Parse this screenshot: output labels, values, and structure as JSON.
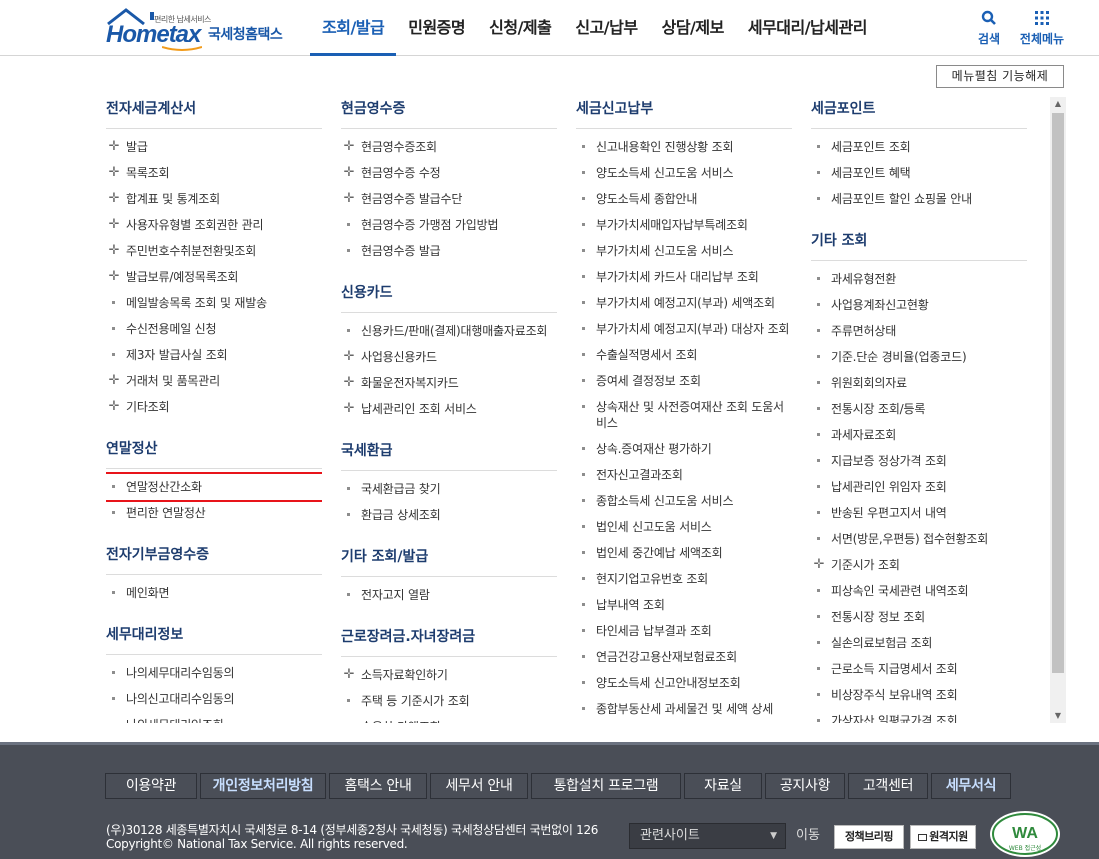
{
  "header": {
    "logo": {
      "small": "편리한 납세서비스",
      "home": "Home",
      "tax": "tax",
      "kr": "국세청홈택스"
    },
    "nav": [
      "조회/발급",
      "민원증명",
      "신청/제출",
      "신고/납부",
      "상담/제보",
      "세무대리/납세관리"
    ],
    "search_label": "검색",
    "all_menu_label": "전체메뉴"
  },
  "fold_button": "메뉴펼침 기능해제",
  "columns": [
    {
      "sections": [
        {
          "title": "전자세금계산서",
          "items": [
            {
              "label": "발급",
              "bullet": "plus"
            },
            {
              "label": "목록조회",
              "bullet": "plus"
            },
            {
              "label": "합계표 및 통계조회",
              "bullet": "plus"
            },
            {
              "label": "사용자유형별 조회권한 관리",
              "bullet": "plus"
            },
            {
              "label": "주민번호수취분전환및조회",
              "bullet": "plus"
            },
            {
              "label": "발급보류/예정목록조회",
              "bullet": "plus"
            },
            {
              "label": "메일발송목록 조회 및 재발송",
              "bullet": "dot"
            },
            {
              "label": "수신전용메일 신청",
              "bullet": "dot"
            },
            {
              "label": "제3자 발급사실 조회",
              "bullet": "dot"
            },
            {
              "label": "거래처 및 품목관리",
              "bullet": "plus"
            },
            {
              "label": "기타조회",
              "bullet": "plus"
            }
          ]
        },
        {
          "title": "연말정산",
          "items": [
            {
              "label": "연말정산간소화",
              "bullet": "dot",
              "highlight": true
            },
            {
              "label": "편리한 연말정산",
              "bullet": "dot"
            }
          ]
        },
        {
          "title": "전자기부금영수증",
          "items": [
            {
              "label": "메인화면",
              "bullet": "dot"
            }
          ]
        },
        {
          "title": "세무대리정보",
          "items": [
            {
              "label": "나의세무대리수임동의",
              "bullet": "dot"
            },
            {
              "label": "나의신고대리수임동의",
              "bullet": "dot"
            },
            {
              "label": "나의세무대리인조회",
              "bullet": "dot"
            }
          ]
        }
      ]
    },
    {
      "sections": [
        {
          "title": "현금영수증",
          "items": [
            {
              "label": "현금영수증조회",
              "bullet": "plus"
            },
            {
              "label": "현금영수증 수정",
              "bullet": "plus"
            },
            {
              "label": "현금영수증 발급수단",
              "bullet": "plus"
            },
            {
              "label": "현금영수증 가맹점 가입방법",
              "bullet": "dot"
            },
            {
              "label": "현금영수증 발급",
              "bullet": "dot"
            }
          ]
        },
        {
          "title": "신용카드",
          "items": [
            {
              "label": "신용카드/판매(결제)대행매출자료조회",
              "bullet": "dot"
            },
            {
              "label": "사업용신용카드",
              "bullet": "plus"
            },
            {
              "label": "화물운전자복지카드",
              "bullet": "plus"
            },
            {
              "label": "납세관리인 조회 서비스",
              "bullet": "plus"
            }
          ]
        },
        {
          "title": "국세환급",
          "items": [
            {
              "label": "국세환급금 찾기",
              "bullet": "dot"
            },
            {
              "label": "환급금 상세조회",
              "bullet": "dot"
            }
          ]
        },
        {
          "title": "기타 조회/발급",
          "items": [
            {
              "label": "전자고지 열람",
              "bullet": "dot"
            }
          ]
        },
        {
          "title": "근로장려금.자녀장려금",
          "items": [
            {
              "label": "소득자료확인하기",
              "bullet": "plus"
            },
            {
              "label": "주택 등 기준시가 조회",
              "bullet": "dot"
            },
            {
              "label": "승용차 가액조회",
              "bullet": "dot"
            }
          ]
        }
      ]
    },
    {
      "sections": [
        {
          "title": "세금신고납부",
          "items": [
            {
              "label": "신고내용확인 진행상황 조회",
              "bullet": "dot"
            },
            {
              "label": "양도소득세 신고도움 서비스",
              "bullet": "dot"
            },
            {
              "label": "양도소득세 종합안내",
              "bullet": "dot"
            },
            {
              "label": "부가가치세매입자납부특례조회",
              "bullet": "dot"
            },
            {
              "label": "부가가치세 신고도움 서비스",
              "bullet": "dot"
            },
            {
              "label": "부가가치세 카드사 대리납부 조회",
              "bullet": "dot"
            },
            {
              "label": "부가가치세 예정고지(부과) 세액조회",
              "bullet": "dot"
            },
            {
              "label": "부가가치세 예정고지(부과) 대상자 조회",
              "bullet": "dot"
            },
            {
              "label": "수출실적명세서 조회",
              "bullet": "dot"
            },
            {
              "label": "증여세 결정정보 조회",
              "bullet": "dot"
            },
            {
              "label": "상속재산 및 사전증여재산 조회 도움서비스",
              "bullet": "dot"
            },
            {
              "label": "상속.증여재산 평가하기",
              "bullet": "dot"
            },
            {
              "label": "전자신고결과조회",
              "bullet": "dot"
            },
            {
              "label": "종합소득세 신고도움 서비스",
              "bullet": "dot"
            },
            {
              "label": "법인세 신고도움 서비스",
              "bullet": "dot"
            },
            {
              "label": "법인세 중간예납 세액조회",
              "bullet": "dot"
            },
            {
              "label": "현지기업고유번호 조회",
              "bullet": "dot"
            },
            {
              "label": "납부내역 조회",
              "bullet": "dot"
            },
            {
              "label": "타인세금 납부결과 조회",
              "bullet": "dot"
            },
            {
              "label": "연금건강고용산재보험료조회",
              "bullet": "dot"
            },
            {
              "label": "양도소득세 신고안내정보조회",
              "bullet": "dot"
            },
            {
              "label": "종합부동산세 과세물건 및 세액 상세",
              "bullet": "dot"
            }
          ]
        }
      ]
    },
    {
      "sections": [
        {
          "title": "세금포인트",
          "items": [
            {
              "label": "세금포인트 조회",
              "bullet": "dot"
            },
            {
              "label": "세금포인트 혜택",
              "bullet": "dot"
            },
            {
              "label": "세금포인트 할인 쇼핑몰 안내",
              "bullet": "dot"
            }
          ]
        },
        {
          "title": "기타 조회",
          "items": [
            {
              "label": "과세유형전환",
              "bullet": "dot"
            },
            {
              "label": "사업용계좌신고현황",
              "bullet": "dot"
            },
            {
              "label": "주류면허상태",
              "bullet": "dot"
            },
            {
              "label": "기준.단순 경비율(업종코드)",
              "bullet": "dot"
            },
            {
              "label": "위원회회의자료",
              "bullet": "dot"
            },
            {
              "label": "전통시장 조회/등록",
              "bullet": "dot"
            },
            {
              "label": "과세자료조회",
              "bullet": "dot"
            },
            {
              "label": "지급보증 정상가격 조회",
              "bullet": "dot"
            },
            {
              "label": "납세관리인 위임자 조회",
              "bullet": "dot"
            },
            {
              "label": "반송된 우편고지서 내역",
              "bullet": "dot"
            },
            {
              "label": "서면(방문,우편등) 접수현황조회",
              "bullet": "dot"
            },
            {
              "label": "기준시가 조회",
              "bullet": "plus"
            },
            {
              "label": "피상속인 국세관련 내역조회",
              "bullet": "dot"
            },
            {
              "label": "전통시장 정보 조회",
              "bullet": "dot"
            },
            {
              "label": "실손의료보험금 조회",
              "bullet": "dot"
            },
            {
              "label": "근로소득 지급명세서 조회",
              "bullet": "dot"
            },
            {
              "label": "비상장주식 보유내역 조회",
              "bullet": "dot"
            },
            {
              "label": "가상자산 일평균가격 조회",
              "bullet": "dot"
            }
          ]
        }
      ]
    }
  ],
  "footer": {
    "links": [
      {
        "label": "이용약관",
        "bold": false
      },
      {
        "label": "개인정보처리방침",
        "bold": true
      },
      {
        "label": "홈택스 안내",
        "bold": false
      },
      {
        "label": "세무서 안내",
        "bold": false
      },
      {
        "label": "통합설치 프로그램",
        "bold": false
      },
      {
        "label": "자료실",
        "bold": false
      },
      {
        "label": "공지사항",
        "bold": false
      },
      {
        "label": "고객센터",
        "bold": false
      },
      {
        "label": "세무서식",
        "bold": true
      }
    ],
    "address": "(우)30128 세종특별자치시 국세청로 8-14 (정부세종2청사 국세청동) 국세청상담센터 국번없이 126",
    "copyright": "Copyright© National Tax Service. All rights reserved.",
    "related_sites": "관련사이트",
    "go": "이동",
    "btn_policy": "정책브리핑",
    "btn_remote": "원격지원",
    "wa_mark": "WA",
    "wa_sub": "WEB 접근성"
  },
  "colors": {
    "accent": "#1a5fb4",
    "highlight": "#e8141a",
    "footer_bg": "#4a4e57"
  }
}
